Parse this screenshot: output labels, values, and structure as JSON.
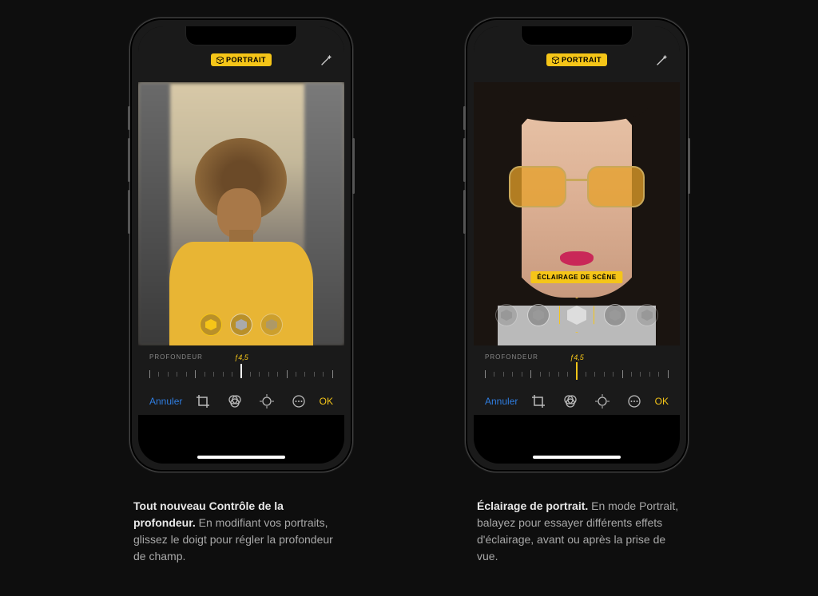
{
  "badge_label": "PORTRAIT",
  "phone1": {
    "depth_label": "PROFONDEUR",
    "fvalue": "ƒ4,5",
    "cancel": "Annuler",
    "ok": "OK"
  },
  "phone2": {
    "scene_label": "ÉCLAIRAGE DE SCÈNE",
    "depth_label": "PROFONDEUR",
    "fvalue": "ƒ4,5",
    "cancel": "Annuler",
    "ok": "OK"
  },
  "caption1": {
    "bold": "Tout nouveau Contrôle de la profondeur.",
    "rest": " En modifiant vos portraits, glissez le doigt pour régler la profondeur de champ."
  },
  "caption2": {
    "bold": "Éclairage de portrait.",
    "rest": " En mode Portrait, balayez pour essayer différents effets d'éclairage, avant ou après la prise de vue."
  }
}
